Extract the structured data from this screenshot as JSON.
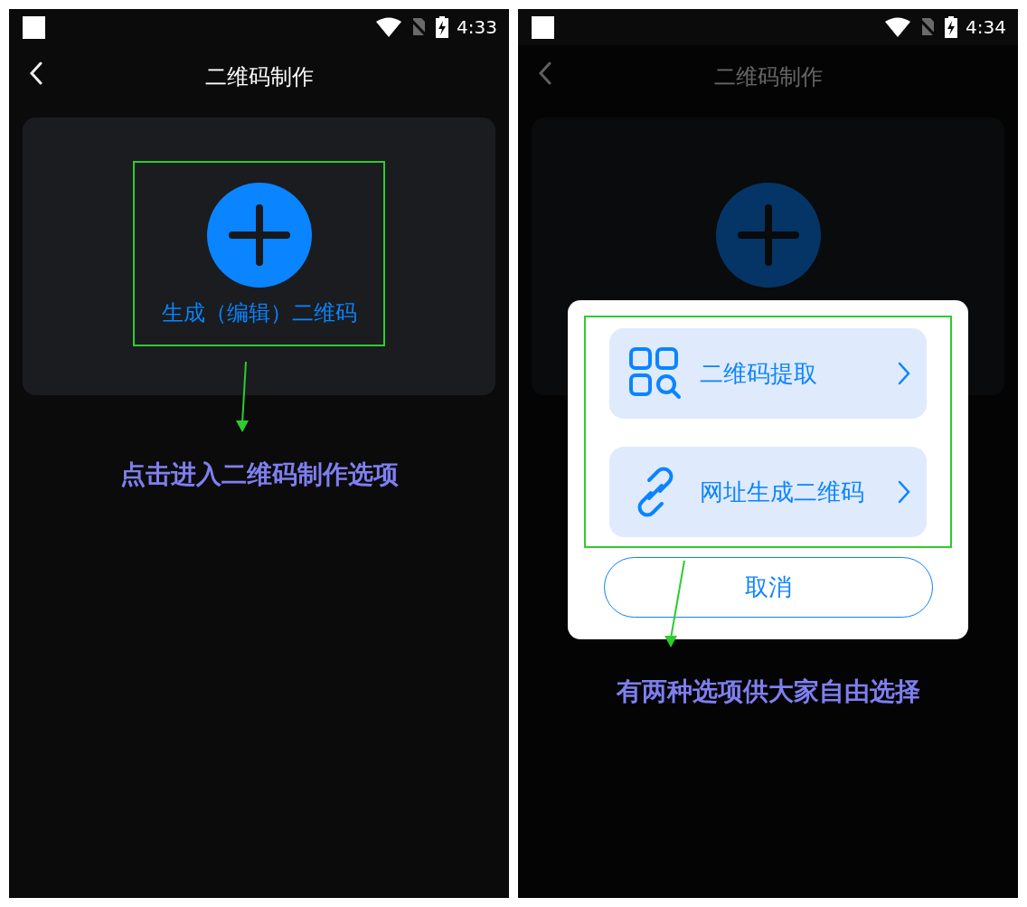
{
  "screens": [
    {
      "status_bar": {
        "time": "4:33"
      },
      "header": {
        "title": "二维码制作"
      },
      "dimmed": false,
      "create_card": {
        "label": "生成（编辑）二维码",
        "highlighted": true
      },
      "annotation": "点击进入二维码制作选项"
    },
    {
      "status_bar": {
        "time": "4:34"
      },
      "header": {
        "title": "二维码制作"
      },
      "dimmed": true,
      "create_card": {
        "highlighted": false
      },
      "dialog": {
        "highlighted": true,
        "options": [
          {
            "kind": "scan",
            "label": "二维码提取"
          },
          {
            "kind": "link",
            "label": "网址生成二维码"
          }
        ],
        "cancel": "取消"
      },
      "annotation": "有两种选项供大家自由选择"
    }
  ]
}
